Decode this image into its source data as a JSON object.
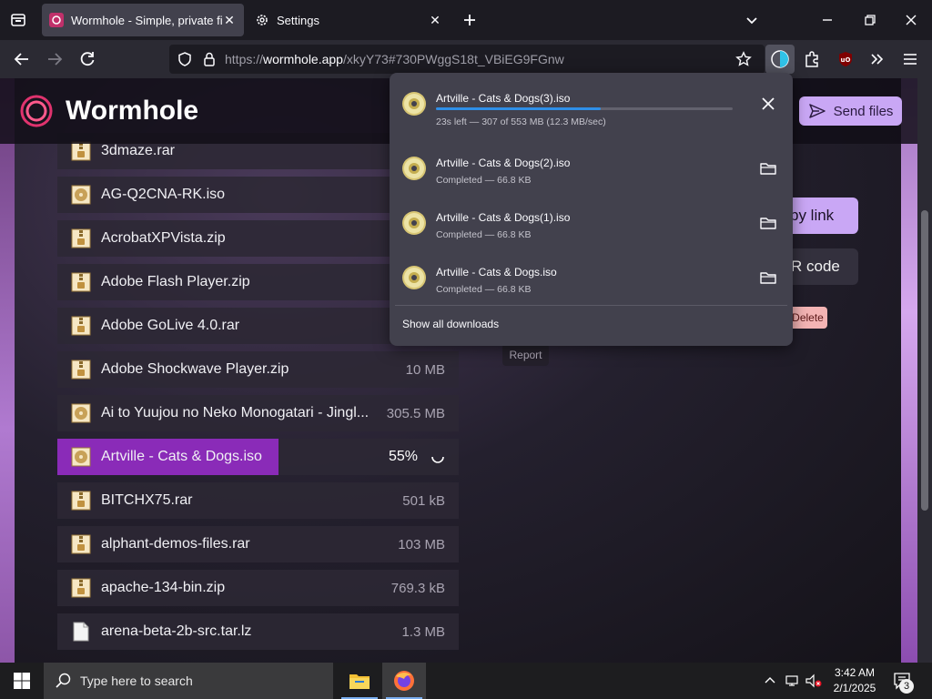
{
  "browser": {
    "tabs": [
      {
        "title": "Wormhole - Simple, private file",
        "active": true
      },
      {
        "title": "Settings",
        "active": false
      }
    ],
    "url": {
      "prefix": "https://",
      "host": "wormhole.app",
      "path": "/xkyY73#730PWggS18t_VBiEG9FGnw"
    }
  },
  "page": {
    "brand": "Wormhole",
    "send_files_label": "Send files",
    "copy_link_label": "py link",
    "qr_code_label": "R code",
    "delete_label": "Delete",
    "report_label": "Report",
    "files": [
      {
        "name": "3dmaze.rar",
        "size": "",
        "icon": "archive"
      },
      {
        "name": "AG-Q2CNA-RK.iso",
        "size": "",
        "icon": "disc"
      },
      {
        "name": "AcrobatXPVista.zip",
        "size": "",
        "icon": "archive"
      },
      {
        "name": "Adobe Flash Player.zip",
        "size": "",
        "icon": "archive"
      },
      {
        "name": "Adobe GoLive 4.0.rar",
        "size": "",
        "icon": "archive"
      },
      {
        "name": "Adobe Shockwave Player.zip",
        "size": "10 MB",
        "icon": "archive"
      },
      {
        "name": "Ai to Yuujou no Neko Monogatari - Jingl...",
        "size": "305.5 MB",
        "icon": "disc"
      },
      {
        "name": "Artville - Cats & Dogs.iso",
        "size": "",
        "icon": "disc",
        "downloading": true,
        "progress_pct": "55%",
        "progress": 0.55
      },
      {
        "name": "BITCHX75.rar",
        "size": "501 kB",
        "icon": "archive"
      },
      {
        "name": "alphant-demos-files.rar",
        "size": "103 MB",
        "icon": "archive"
      },
      {
        "name": "apache-134-bin.zip",
        "size": "769.3 kB",
        "icon": "archive"
      },
      {
        "name": "arena-beta-2b-src.tar.lz",
        "size": "1.3 MB",
        "icon": "file"
      }
    ]
  },
  "downloads_panel": {
    "items": [
      {
        "name": "Artville - Cats & Dogs(3).iso",
        "status": "23s left — 307 of 553 MB (12.3 MB/sec)",
        "in_progress": true,
        "progress": 0.555,
        "action": "cancel"
      },
      {
        "name": "Artville - Cats & Dogs(2).iso",
        "status": "Completed — 66.8 KB",
        "in_progress": false,
        "action": "open-folder"
      },
      {
        "name": "Artville - Cats & Dogs(1).iso",
        "status": "Completed — 66.8 KB",
        "in_progress": false,
        "action": "open-folder"
      },
      {
        "name": "Artville - Cats & Dogs.iso",
        "status": "Completed — 66.8 KB",
        "in_progress": false,
        "action": "open-folder"
      }
    ],
    "show_all_label": "Show all downloads"
  },
  "taskbar": {
    "search_placeholder": "Type here to search",
    "time": "3:42 AM",
    "date": "2/1/2025",
    "notification_count": "3"
  },
  "colors": {
    "accent_purple": "#c9a7f5",
    "progress_purple": "#8a2bb8",
    "download_blue": "#2f8fe8"
  }
}
